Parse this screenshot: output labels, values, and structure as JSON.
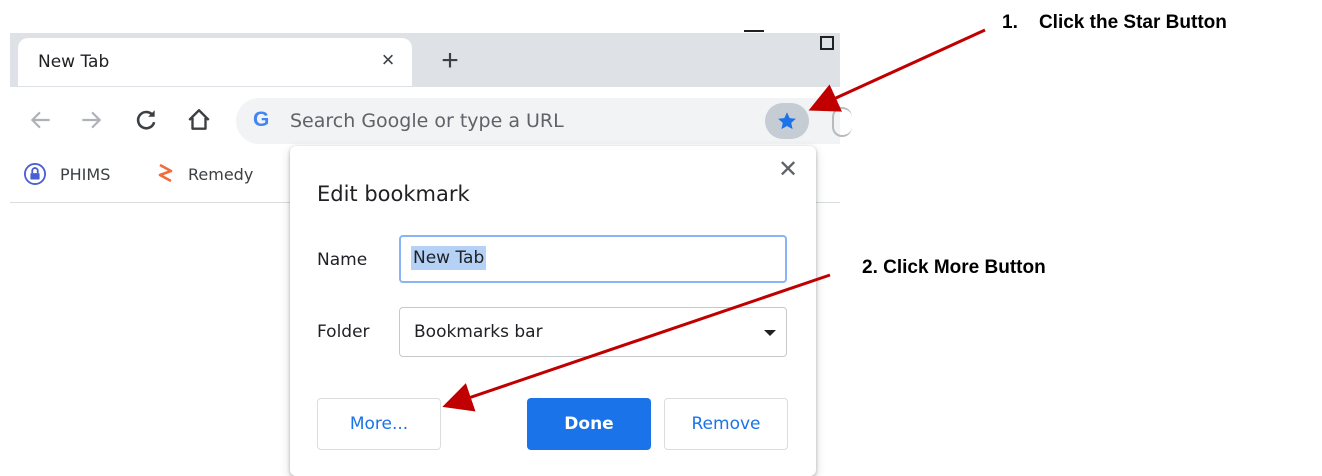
{
  "browser": {
    "tab": {
      "title": "New Tab"
    },
    "omnibox": {
      "placeholder": "Search Google or type a URL",
      "logo": "G"
    },
    "bookmarks_bar": {
      "items": [
        {
          "label": "PHIMS",
          "icon": "lock-icon"
        },
        {
          "label": "Remedy",
          "icon": "remedy-logo-icon"
        }
      ]
    }
  },
  "dialog": {
    "title": "Edit bookmark",
    "name_label": "Name",
    "name_value": "New Tab",
    "folder_label": "Folder",
    "folder_value": "Bookmarks bar",
    "buttons": {
      "more": "More...",
      "done": "Done",
      "remove": "Remove"
    }
  },
  "annotations": {
    "step1": "1.    Click the Star Button",
    "step2": "2. Click More Button"
  },
  "colors": {
    "accent": "#1a73e8",
    "star": "#1a73e8",
    "arrow": "#c00000"
  }
}
